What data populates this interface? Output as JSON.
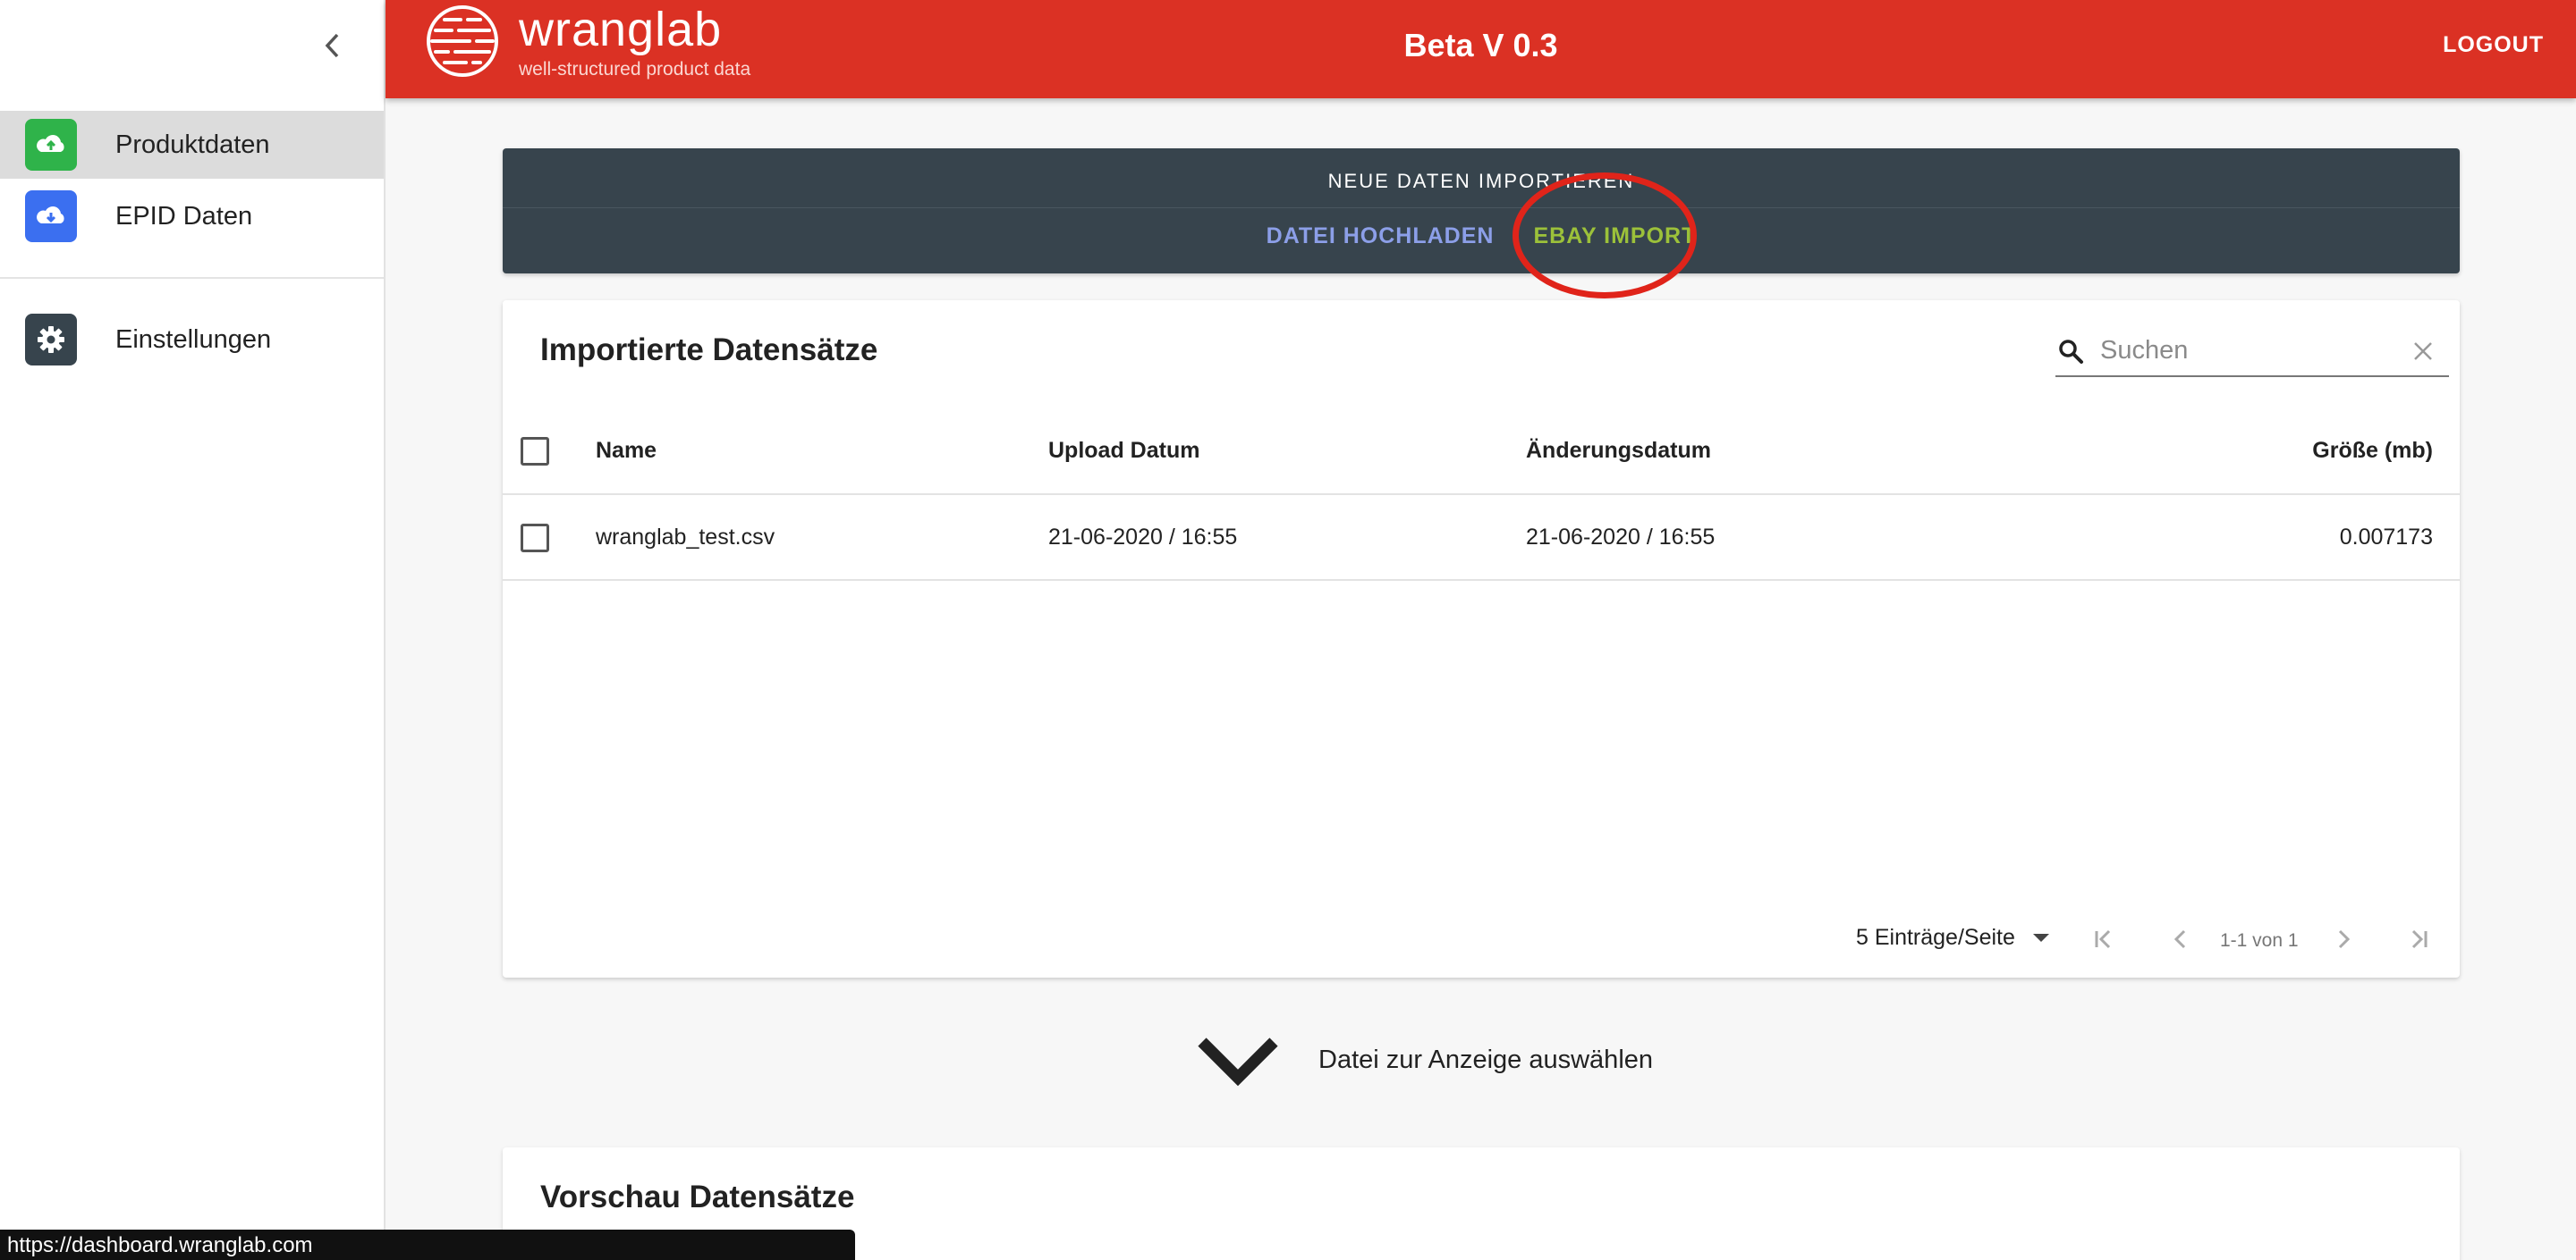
{
  "sidebar": {
    "collapse_icon": "chevron-left-icon",
    "items": [
      {
        "label": "Produktdaten",
        "icon": "cloud-upload-icon",
        "color": "#2fb34a",
        "active": true
      },
      {
        "label": "EPID Daten",
        "icon": "cloud-download-icon",
        "color": "#3b6ff0",
        "active": false
      },
      {
        "label": "Einstellungen",
        "icon": "gear-icon",
        "color": "#37444d",
        "active": false
      }
    ]
  },
  "topbar": {
    "brand": "wranglab",
    "tagline": "well-structured product data",
    "version": "Beta V 0.3",
    "logout": "LOGOUT",
    "color": "#db3124"
  },
  "import": {
    "title": "NEUE DATEN IMPORTIEREN",
    "tabs": [
      "DATEI HOCHLADEN",
      "EBAY IMPORT"
    ]
  },
  "table": {
    "title": "Importierte Datensätze",
    "search_placeholder": "Suchen",
    "columns": [
      "Name",
      "Upload Datum",
      "Änderungsdatum",
      "Größe (mb)"
    ],
    "rows": [
      {
        "name": "wranglab_test.csv",
        "upload": "21-06-2020 / 16:55",
        "changed": "21-06-2020 / 16:55",
        "size": "0.007173"
      }
    ],
    "per_page": "5 Einträge/Seite",
    "range": "1-1 von 1"
  },
  "select_hint": "Datei zur Anzeige auswählen",
  "preview": {
    "title": "Vorschau Datensätze"
  },
  "statusbar": {
    "url": "https://dashboard.wranglab.com"
  }
}
